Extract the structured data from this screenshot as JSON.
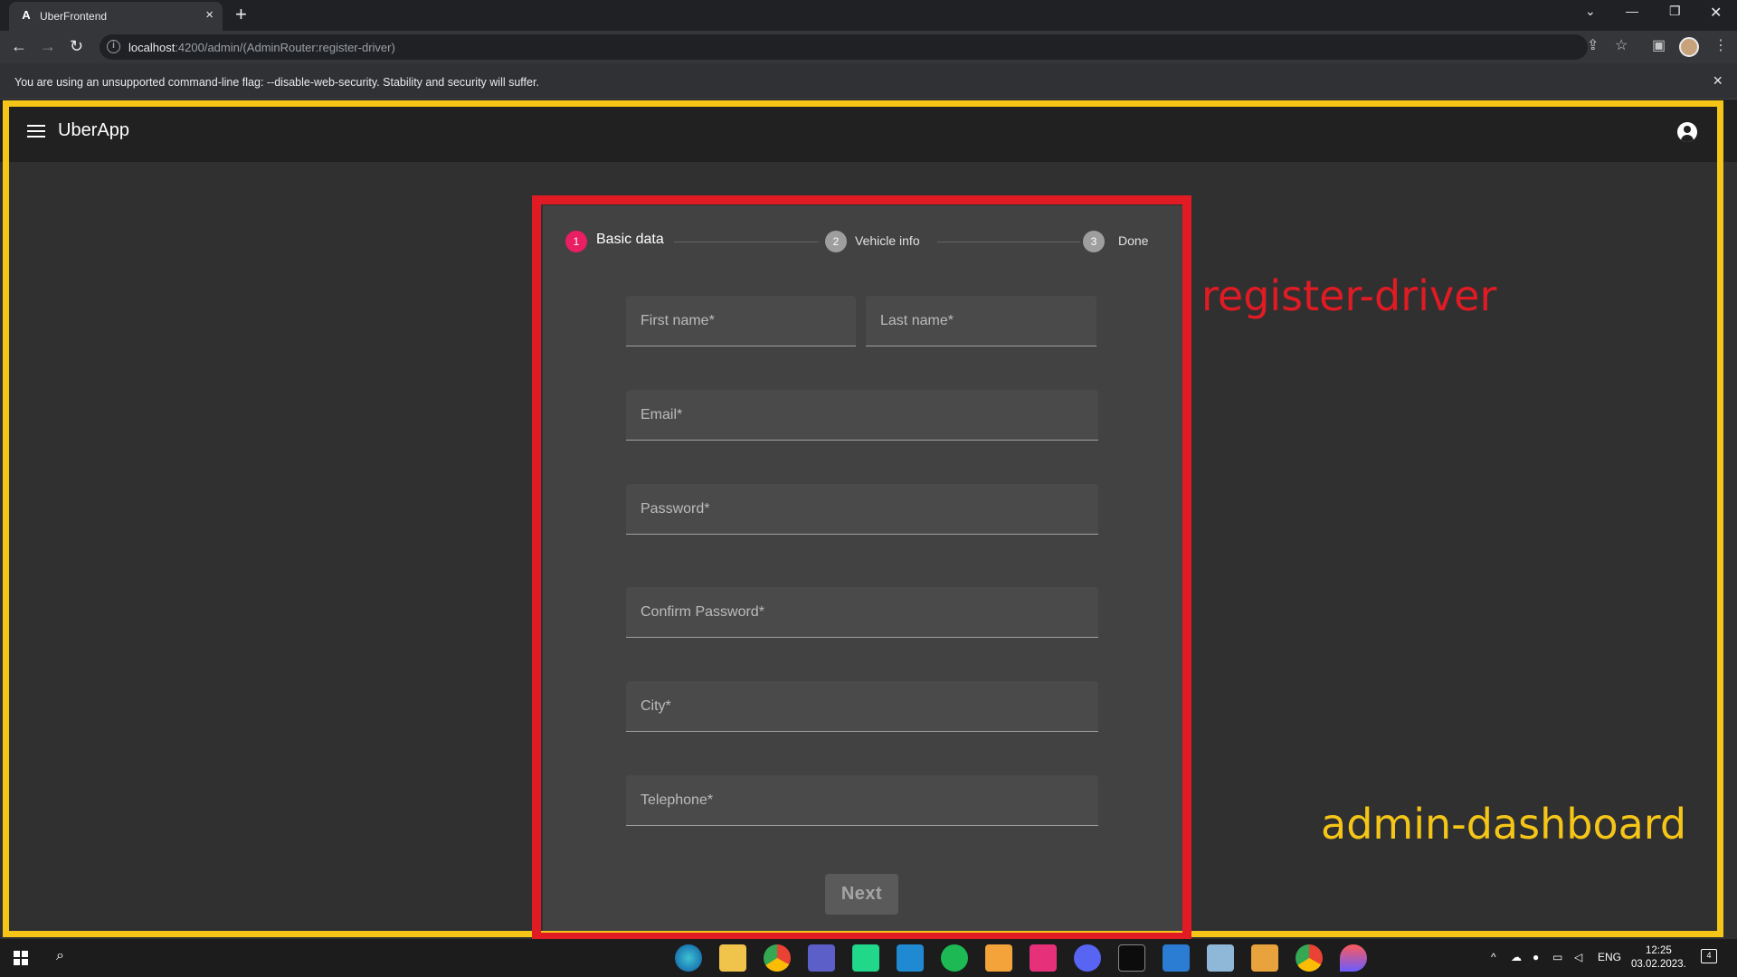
{
  "browser": {
    "tab_title": "UberFrontend",
    "tab_icon": "A",
    "tab_close": "×",
    "new_tab": "+",
    "url_host": "localhost",
    "url_rest": ":4200/admin/(AdminRouter:register-driver)",
    "warning": "You are using an unsupported command-line flag: --disable-web-security. Stability and security will suffer.",
    "warning_close": "×"
  },
  "app": {
    "brand": "UberApp"
  },
  "stepper": {
    "steps": [
      {
        "number": "1",
        "label": "Basic data",
        "state": "active",
        "color": "#e91e63"
      },
      {
        "number": "2",
        "label": "Vehicle info",
        "state": "pending",
        "color": "#9e9e9e"
      },
      {
        "number": "3",
        "label": "Done",
        "state": "pending",
        "color": "#9e9e9e"
      }
    ]
  },
  "form": {
    "first_name": {
      "placeholder": "First name*",
      "value": ""
    },
    "last_name": {
      "placeholder": "Last name*",
      "value": ""
    },
    "email": {
      "placeholder": "Email*",
      "value": ""
    },
    "password": {
      "placeholder": "Password*",
      "value": ""
    },
    "confirm_password": {
      "placeholder": "Confirm Password*",
      "value": ""
    },
    "city": {
      "placeholder": "City*",
      "value": ""
    },
    "telephone": {
      "placeholder": "Telephone*",
      "value": ""
    },
    "next_label": "Next"
  },
  "annotations": {
    "inner_component": "register-driver",
    "outer_component": "admin-dashboard",
    "inner_color": "#e01b24",
    "outer_color": "#f5c518"
  },
  "taskbar": {
    "language": "ENG",
    "time": "12:25",
    "date": "03.02.2023.",
    "notification_count": "4"
  }
}
